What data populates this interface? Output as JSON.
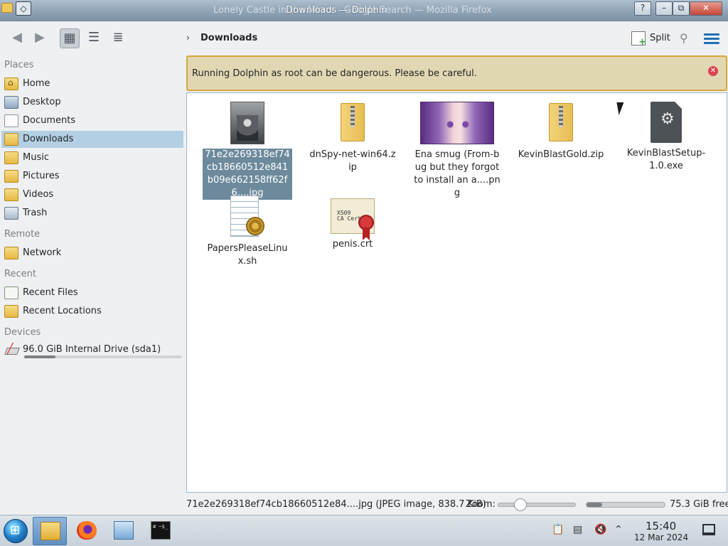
{
  "titlebar": {
    "behind_title": "Lonely Castle in the Mirror - Google Search — Mozilla Firefox",
    "title": "Downloads — Dolphin",
    "help": "?",
    "minimize": "–",
    "maximize": "⧉",
    "close": "✕",
    "menu": "◇"
  },
  "toolbar": {
    "back_icon": "◀",
    "forward_icon": "▶",
    "view_icons_icon": "▦",
    "view_compact_icon": "☰",
    "view_details_icon": "≣",
    "breadcrumb_chevron": "›",
    "breadcrumb": "Downloads",
    "split_label": "Split",
    "search_icon": "⚲"
  },
  "sidebar": {
    "places_title": "Places",
    "places": [
      {
        "label": "Home",
        "icon": "home-folder-icon"
      },
      {
        "label": "Desktop",
        "icon": "desktop-icon"
      },
      {
        "label": "Documents",
        "icon": "documents-icon"
      },
      {
        "label": "Downloads",
        "icon": "downloads-folder-icon"
      },
      {
        "label": "Music",
        "icon": "music-folder-icon"
      },
      {
        "label": "Pictures",
        "icon": "pictures-folder-icon"
      },
      {
        "label": "Videos",
        "icon": "videos-folder-icon"
      },
      {
        "label": "Trash",
        "icon": "trash-icon"
      }
    ],
    "remote_title": "Remote",
    "remote": [
      {
        "label": "Network",
        "icon": "network-folder-icon"
      }
    ],
    "recent_title": "Recent",
    "recent": [
      {
        "label": "Recent Files",
        "icon": "recent-files-icon"
      },
      {
        "label": "Recent Locations",
        "icon": "recent-locations-icon"
      }
    ],
    "devices_title": "Devices",
    "devices": [
      {
        "label": "96.0 GiB Internal Drive (sda1)",
        "icon": "drive-icon",
        "usage_fraction": 0.2
      }
    ]
  },
  "banner": {
    "text": "Running Dolphin as root can be dangerous. Please be careful.",
    "close": "✕"
  },
  "files": [
    {
      "name": "71e2e269318ef74cb18660512e841b09e662158ff62f6....jpg",
      "type": "jpeg-image",
      "selected": true
    },
    {
      "name": "dnSpy-net-win64.zip",
      "type": "zip-archive",
      "selected": false
    },
    {
      "name": "Ena smug (From-bug but they forgot to install an a....png",
      "type": "png-image",
      "selected": false
    },
    {
      "name": "KevinBlastGold.zip",
      "type": "zip-archive",
      "selected": false
    },
    {
      "name": "KevinBlastSetup-1.0.exe",
      "type": "executable",
      "selected": false
    },
    {
      "name": "PapersPleaseLinux.sh",
      "type": "shell-script",
      "selected": false
    },
    {
      "name": "penis.crt",
      "type": "certificate",
      "selected": false
    }
  ],
  "cert_text": "X509\nCA Cert",
  "statusbar": {
    "file_info": "71e2e269318ef74cb18660512e84....jpg (JPEG image, 838.7 KiB)",
    "zoom_label": "Zoom:",
    "zoom_fraction": 0.28,
    "space_used_fraction": 0.2,
    "free_space": "75.3 GiB free"
  },
  "taskbar": {
    "terminal_text": "# ~$_",
    "tray_clipboard": "📋",
    "tray_notes": "▤",
    "tray_volume": "🔇",
    "tray_expand": "⌃",
    "time": "15:40",
    "date": "12 Mar 2024"
  }
}
